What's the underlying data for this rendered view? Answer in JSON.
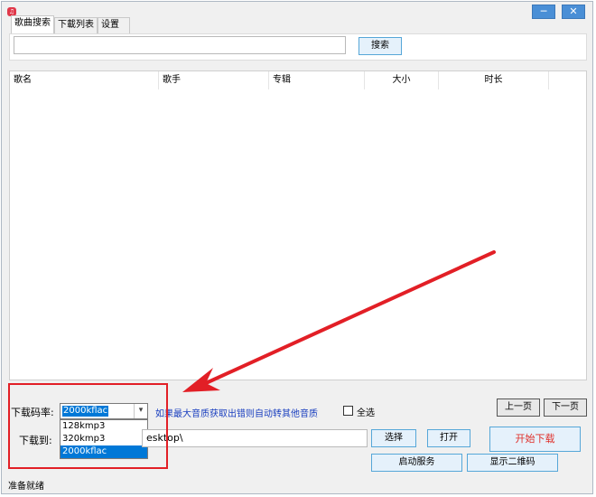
{
  "window": {
    "app_icon": "app-logo-icon",
    "minimize_glyph": "─",
    "close_glyph": "✕"
  },
  "tabs": [
    "歌曲搜索",
    "下載列表",
    "设置"
  ],
  "search": {
    "value": "",
    "button_label": "搜索"
  },
  "table": {
    "columns": [
      "歌名",
      "歌手",
      "专辑",
      "大小",
      "时长"
    ],
    "rows": []
  },
  "bitrate": {
    "label": "下载码率:",
    "selected": "2000kflac",
    "options": [
      "128kmp3",
      "320kmp3",
      "2000kflac"
    ],
    "hint": "如果最大音质获取出错则自动转其他音质"
  },
  "select_all": {
    "label": "全选",
    "checked": false
  },
  "pager": {
    "prev_label": "上一页",
    "next_label": "下一页"
  },
  "download_to": {
    "label": "下载到:",
    "path_visible": "esktop\\"
  },
  "buttons": {
    "choose": "选择",
    "open": "打开",
    "start_download": "开始下载",
    "start_service": "启动服务",
    "show_qr": "显示二维码"
  },
  "status": "准备就绪",
  "colors": {
    "accent_blue": "#0078d7",
    "hint_text": "#1a3fbf",
    "start_download_text": "#e0302a",
    "annotation_red": "#e21f26",
    "window_button_blue": "#4a8fd6"
  }
}
